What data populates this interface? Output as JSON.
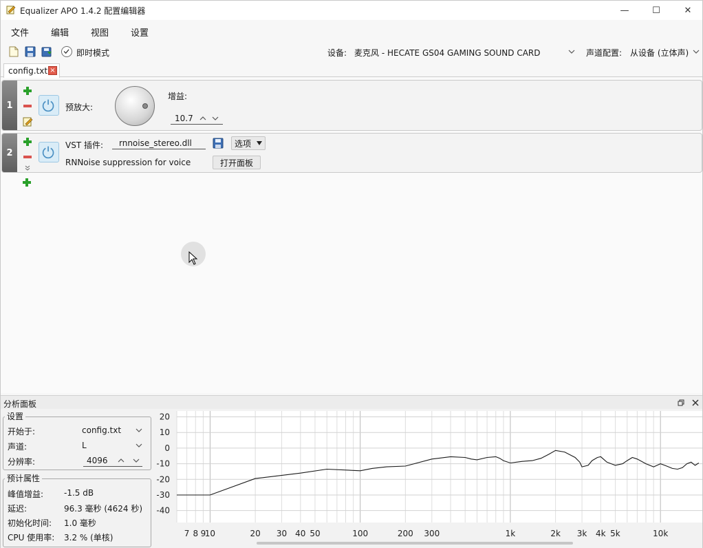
{
  "window": {
    "title": "Equalizer APO 1.4.2 配置编辑器",
    "controls": {
      "minimize": "—",
      "maximize": "☐",
      "close": "✕"
    }
  },
  "menu": {
    "items": [
      "文件",
      "编辑",
      "视图",
      "设置"
    ]
  },
  "toolbar": {
    "instant_mode_label": "即时模式",
    "device_label": "设备:",
    "device_value": "麦克风 - HECATE GS04 GAMING SOUND CARD",
    "channel_label": "声道配置:",
    "channel_value": "从设备 (立体声)"
  },
  "tabs": [
    {
      "label": "config.txt"
    }
  ],
  "filters": [
    {
      "index": "1",
      "type_label": "预放大:",
      "gain_label": "增益:",
      "gain_value": "10.7"
    },
    {
      "index": "2",
      "type_label": "VST 插件:",
      "file": "rnnoise_stereo.dll",
      "options_label": "选项",
      "description": "RNNoise suppression for voice",
      "open_panel_label": "打开面板"
    }
  ],
  "analysis": {
    "title": "分析面板",
    "settings": {
      "group_title": "设置",
      "start_label": "开始于:",
      "start_value": "config.txt",
      "channel_label": "声道:",
      "channel_value": "L",
      "resolution_label": "分辨率:",
      "resolution_value": "4096"
    },
    "estimates": {
      "group_title": "预计属性",
      "peak_label": "峰值增益:",
      "peak_value": "-1.5 dB",
      "latency_label": "延迟:",
      "latency_value": "96.3 毫秒 (4624 秒)",
      "init_label": "初始化时间:",
      "init_value": "1.0 毫秒",
      "cpu_label": "CPU 使用率:",
      "cpu_value": "3.2 % (单核)"
    }
  },
  "chart_data": {
    "type": "line",
    "y_ticks": [
      "20",
      "10",
      "0",
      "-10",
      "-20",
      "-30",
      "-40"
    ],
    "ylim": [
      -45,
      22
    ],
    "x_scale": "log",
    "xlim": [
      6,
      19000
    ],
    "x_tick_labels": [
      {
        "f": 7,
        "label": "7"
      },
      {
        "f": 8,
        "label": "8"
      },
      {
        "f": 9,
        "label": "9"
      },
      {
        "f": 10,
        "label": "10"
      },
      {
        "f": 20,
        "label": "20"
      },
      {
        "f": 30,
        "label": "30"
      },
      {
        "f": 40,
        "label": "40"
      },
      {
        "f": 50,
        "label": "50"
      },
      {
        "f": 100,
        "label": "100"
      },
      {
        "f": 200,
        "label": "200"
      },
      {
        "f": 300,
        "label": "300"
      },
      {
        "f": 1000,
        "label": "1k"
      },
      {
        "f": 2000,
        "label": "2k"
      },
      {
        "f": 3000,
        "label": "3k"
      },
      {
        "f": 4000,
        "label": "4k"
      },
      {
        "f": 5000,
        "label": "5k"
      },
      {
        "f": 10000,
        "label": "10k"
      }
    ],
    "series": [
      {
        "color": "#1a1a1a",
        "points": [
          [
            6,
            -30
          ],
          [
            10,
            -30
          ],
          [
            20,
            -19.5
          ],
          [
            40,
            -16
          ],
          [
            60,
            -13.5
          ],
          [
            100,
            -14.5
          ],
          [
            120,
            -13
          ],
          [
            150,
            -12
          ],
          [
            200,
            -11.5
          ],
          [
            300,
            -7
          ],
          [
            400,
            -5.5
          ],
          [
            500,
            -6
          ],
          [
            550,
            -7
          ],
          [
            600,
            -7.5
          ],
          [
            700,
            -6
          ],
          [
            800,
            -5.5
          ],
          [
            850,
            -6.5
          ],
          [
            900,
            -8
          ],
          [
            1000,
            -9.5
          ],
          [
            1100,
            -9
          ],
          [
            1200,
            -8.5
          ],
          [
            1400,
            -8
          ],
          [
            1600,
            -6.5
          ],
          [
            1800,
            -4
          ],
          [
            2000,
            -1.5
          ],
          [
            2300,
            -2.5
          ],
          [
            2700,
            -6
          ],
          [
            2900,
            -9
          ],
          [
            3000,
            -12
          ],
          [
            3300,
            -11
          ],
          [
            3500,
            -8
          ],
          [
            3800,
            -6
          ],
          [
            4000,
            -5.5
          ],
          [
            4400,
            -9
          ],
          [
            5000,
            -11
          ],
          [
            5600,
            -10
          ],
          [
            6000,
            -8
          ],
          [
            6500,
            -6
          ],
          [
            7000,
            -7
          ],
          [
            8000,
            -10
          ],
          [
            9000,
            -12
          ],
          [
            9500,
            -11
          ],
          [
            10000,
            -10
          ],
          [
            11000,
            -11.5
          ],
          [
            12000,
            -13
          ],
          [
            13000,
            -13.5
          ],
          [
            14000,
            -12.5
          ],
          [
            15000,
            -10
          ],
          [
            16000,
            -9
          ],
          [
            17000,
            -11
          ],
          [
            18000,
            -9.5
          ]
        ]
      }
    ]
  }
}
